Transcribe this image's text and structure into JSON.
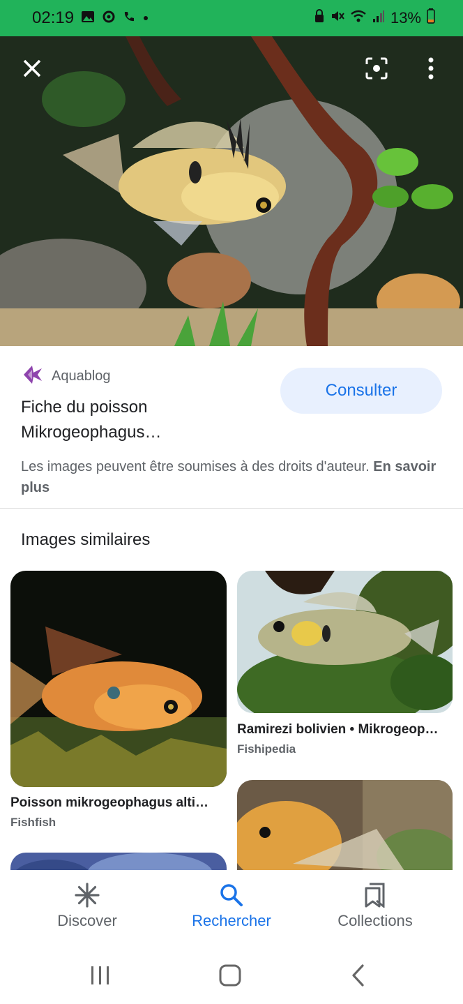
{
  "status_bar": {
    "time": "02:19",
    "battery": "13%"
  },
  "hero": {
    "close_label": "close",
    "lens_label": "lens",
    "menu_label": "more"
  },
  "result": {
    "source": "Aquablog",
    "title_line1": "Fiche du poisson",
    "title_line2": "Mikrogeophagus…",
    "consult_label": "Consulter",
    "rights_text": "Les images peuvent être soumises à des droits d'auteur.",
    "rights_link": "En savoir plus"
  },
  "similar": {
    "heading": "Images similaires",
    "items": [
      {
        "title": "Poisson mikrogeophagus alti…",
        "source": "Fishfish"
      },
      {
        "title": "Ramirezi bolivien • Mikrogeop…",
        "source": "Fishipedia"
      }
    ]
  },
  "nav": {
    "items": [
      {
        "label": "Discover"
      },
      {
        "label": "Rechercher"
      },
      {
        "label": "Collections"
      }
    ]
  },
  "colors": {
    "status_bar": "#21b35a",
    "accent": "#1a73e8",
    "consult_bg": "#e8f0fe"
  }
}
